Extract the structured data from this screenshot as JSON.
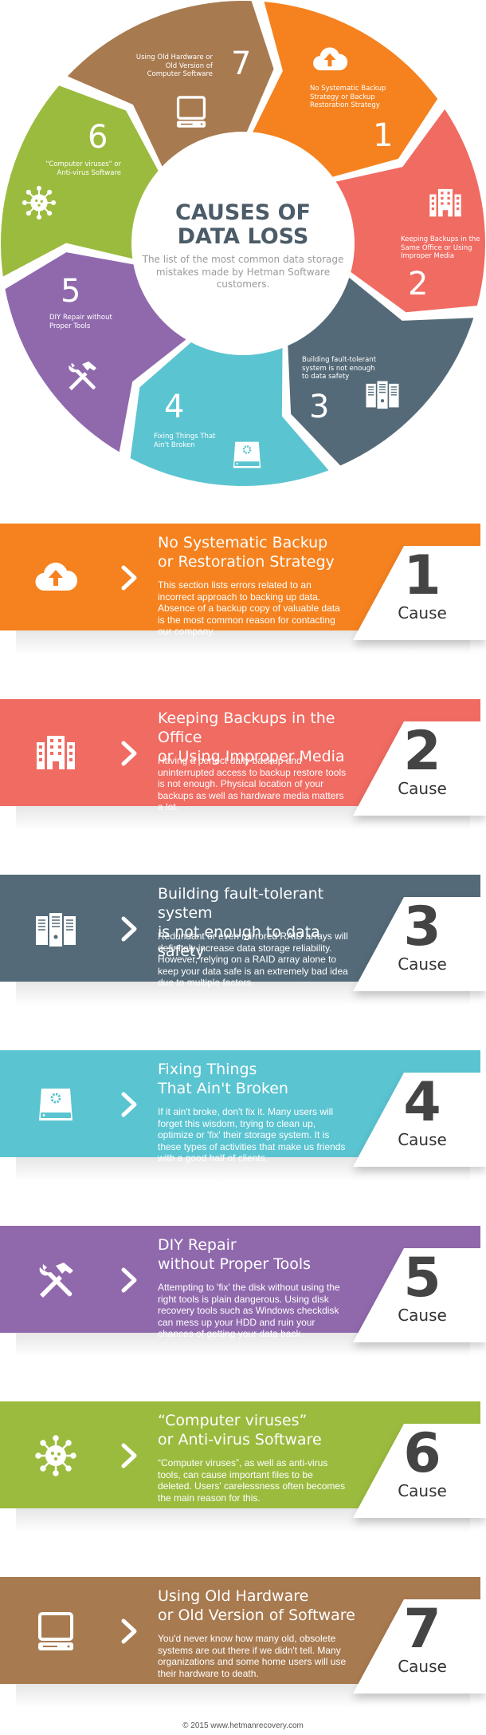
{
  "wheel": {
    "title": "CAUSES OF\nDATA LOSS",
    "subtitle": "The list of the most common data storage mistakes made by Hetman Software customers.",
    "segments": [
      {
        "number": "1",
        "label": "No Systematic Backup\nStrategy or Backup\nRestoration Strategy",
        "icon": "cloud-upload-icon",
        "color": "#f5821f"
      },
      {
        "number": "2",
        "label": "Keeping Backups in the\nSame Office or Using\nImproper Media",
        "icon": "building-icon",
        "color": "#f06b62"
      },
      {
        "number": "3",
        "label": "Building fault-tolerant\nsystem is not enough\nto data safety",
        "icon": "server-icon",
        "color": "#546a78"
      },
      {
        "number": "4",
        "label": "Fixing Things That\nAin't Broken",
        "icon": "hard-disk-icon",
        "color": "#5bc4d1"
      },
      {
        "number": "5",
        "label": "DIY Repair without\nProper Tools",
        "icon": "tools-icon",
        "color": "#9069ad"
      },
      {
        "number": "6",
        "label": "\"Computer viruses\" or\nAnti-virus Software",
        "icon": "virus-icon",
        "color": "#9bbb3f"
      },
      {
        "number": "7",
        "label": "Using Old Hardware or\nOld Version of\nComputer Software",
        "icon": "computer-icon",
        "color": "#a87a50"
      }
    ]
  },
  "causes": [
    {
      "number": "1",
      "cause_label": "Cause",
      "title": "No Systematic Backup\nor Restoration Strategy",
      "body": "This section lists errors related to an incorrect approach to backing up data. Absence of a backup copy of valuable data is the most common reason for contacting our company.",
      "icon": "cloud-upload-icon",
      "color": "#f5821f"
    },
    {
      "number": "2",
      "cause_label": "Cause",
      "title": "Keeping Backups in the Office\nor Using Improper Media",
      "body": "Having a perfect daily backup and uninterrupted access to backup restore tools is not enough. Physical location of your backups as well as hardware media matters a lot.",
      "icon": "building-icon",
      "color": "#f06b62"
    },
    {
      "number": "3",
      "cause_label": "Cause",
      "title": "Building fault-tolerant system\nis not enough to data safety",
      "body": "Redundant or even mirrored RAID arrays will definitely increase data storage reliability. However, relying on a RAID array alone to keep your data safe is an extremely bad idea due to multiple factors.",
      "icon": "server-icon",
      "color": "#546a78"
    },
    {
      "number": "4",
      "cause_label": "Cause",
      "title": "Fixing Things\nThat Ain't Broken",
      "body": "If it ain't broke, don't fix it. Many users will forget this wisdom, trying to clean up, optimize or 'fix' their storage system. It is these types of activities that make us friends with a good half of clients.",
      "icon": "hard-disk-icon",
      "color": "#5bc4d1"
    },
    {
      "number": "5",
      "cause_label": "Cause",
      "title": "DIY Repair\nwithout Proper Tools",
      "body": "Attempting to 'fix' the disk without using the right tools is plain dangerous. Using disk recovery tools such as Windows checkdisk can mess up your HDD and ruin your chances of getting your data back.",
      "icon": "tools-icon",
      "color": "#9069ad"
    },
    {
      "number": "6",
      "cause_label": "Cause",
      "title": "“Computer viruses”\nor Anti-virus Software",
      "body": "“Computer viruses”, as well as anti-virus tools, can cause important files to be deleted. Users' carelessness often becomes the main reason for this.",
      "icon": "virus-icon",
      "color": "#9bbb3f"
    },
    {
      "number": "7",
      "cause_label": "Cause",
      "title": "Using Old Hardware\nor Old Version of Software",
      "body": "You'd never know how many old, obsolete systems are out there if we didn't tell. Many organizations and some home users will use their hardware to death.",
      "icon": "computer-icon",
      "color": "#a87a50"
    }
  ],
  "footer": "© 2015 www.hetmanrecovery.com"
}
